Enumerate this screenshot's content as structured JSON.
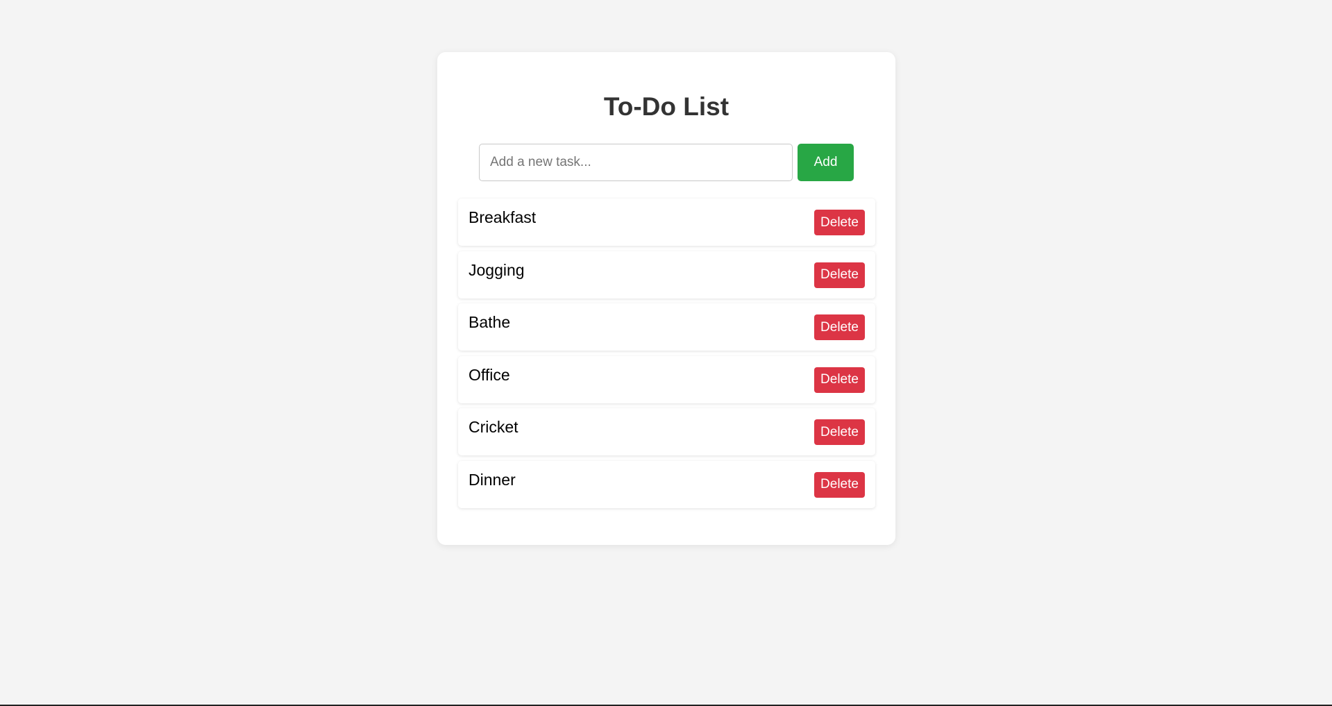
{
  "app": {
    "title": "To-Do List"
  },
  "new_task": {
    "value": "",
    "placeholder": "Add a new task...",
    "add_label": "Add"
  },
  "tasks": [
    {
      "text": "Breakfast",
      "delete_label": "Delete"
    },
    {
      "text": "Jogging",
      "delete_label": "Delete"
    },
    {
      "text": "Bathe",
      "delete_label": "Delete"
    },
    {
      "text": "Office",
      "delete_label": "Delete"
    },
    {
      "text": "Cricket",
      "delete_label": "Delete"
    },
    {
      "text": "Dinner",
      "delete_label": "Delete"
    }
  ],
  "colors": {
    "background": "#f4f4f4",
    "card": "#ffffff",
    "title": "#333333",
    "add_button": "#28a745",
    "delete_button": "#dc3545"
  }
}
